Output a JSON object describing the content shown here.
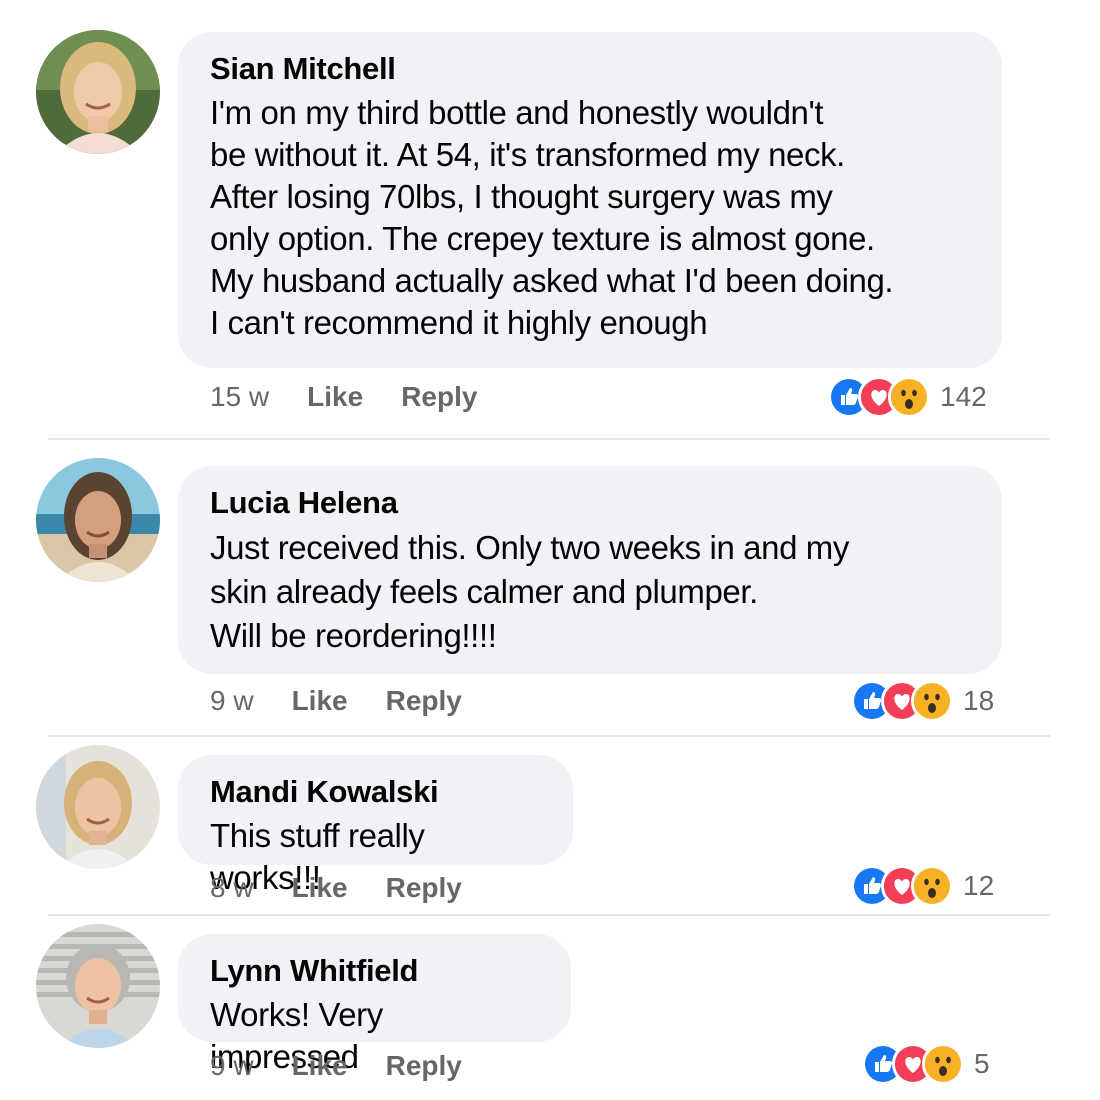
{
  "comments": [
    {
      "name": "Sian Mitchell",
      "text": "I'm on my third bottle and honestly wouldn't\nbe without it. At 54, it's transformed my neck.\nAfter losing 70lbs, I thought surgery was my\nonly option. The crepey texture is almost gone.\nMy husband actually asked what I'd been doing.\nI can't recommend it highly enough",
      "time": "15 w",
      "like_label": "Like",
      "reply_label": "Reply",
      "reaction_count": "142",
      "reactions": [
        "like-icon",
        "love-icon",
        "wow-icon"
      ]
    },
    {
      "name": "Lucia Helena",
      "text": "Just received this. Only two weeks in and my\nskin already feels calmer and plumper.\nWill be reordering!!!!",
      "time": "9 w",
      "like_label": "Like",
      "reply_label": "Reply",
      "reaction_count": "18",
      "reactions": [
        "like-icon",
        "love-icon",
        "wow-icon"
      ]
    },
    {
      "name": "Mandi Kowalski",
      "text": "This stuff really works!!!",
      "time": "8 w",
      "like_label": "Like",
      "reply_label": "Reply",
      "reaction_count": "12",
      "reactions": [
        "like-icon",
        "love-icon",
        "wow-icon"
      ]
    },
    {
      "name": "Lynn Whitfield",
      "text": "Works! Very impressed",
      "time": "9 w",
      "like_label": "Like",
      "reply_label": "Reply",
      "reaction_count": "5",
      "reactions": [
        "like-icon",
        "love-icon",
        "wow-icon"
      ]
    }
  ],
  "colors": {
    "bubble": "#f0f2f5",
    "meta_text": "#65676b",
    "like_blue": "#1877f2",
    "love_red": "#f33e58",
    "wow_yellow": "#f7b125"
  }
}
